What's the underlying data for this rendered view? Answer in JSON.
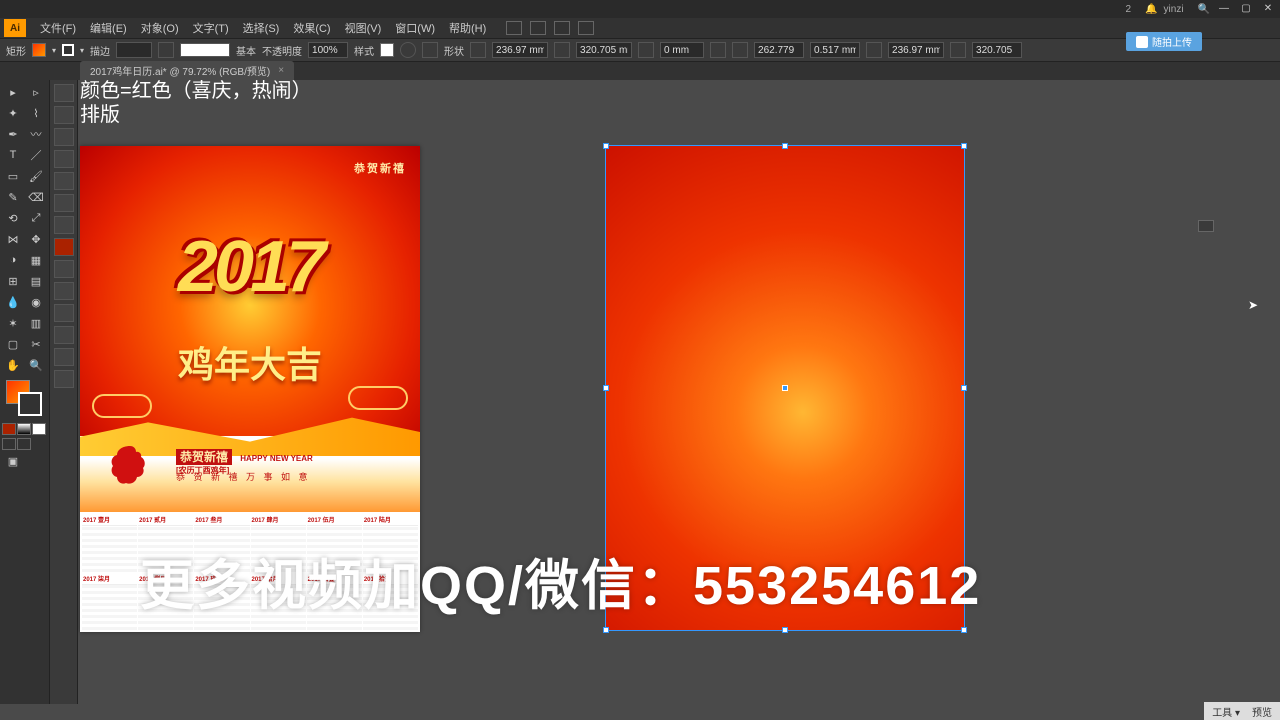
{
  "window": {
    "user": "yinzi",
    "notif": "2"
  },
  "menus": [
    "文件(F)",
    "编辑(E)",
    "对象(O)",
    "文字(T)",
    "选择(S)",
    "效果(C)",
    "视图(V)",
    "窗口(W)",
    "帮助(H)"
  ],
  "control": {
    "label1": "矩形",
    "stroke_label": "描边",
    "style_label": "基本",
    "opacity_label": "不透明度",
    "opacity_val": "100%",
    "style2": "样式",
    "shape_label": "形状",
    "w1": "236.97 mm",
    "h1": "320.705 mm",
    "x1": "0 mm",
    "r1": "262.779",
    "r2": "0.517 mm",
    "w2": "236.97 mm",
    "h2": "320.705"
  },
  "tab": {
    "name": "2017鸡年日历.ai* @ 79.72% (RGB/预览)"
  },
  "canvas_notes": {
    "line1": "颜色=红色（喜庆，热闹）",
    "line2": "排版"
  },
  "poster": {
    "corner": "恭贺新禧",
    "year": "2017",
    "subtitle": "鸡年大吉",
    "greet_en": "HAPPY NEW YEAR",
    "greet_sub": "[农历丁酉鸡年]",
    "greet2": "恭 贺 新 禧  万 事 如 意",
    "months": [
      "2017 壹月",
      "2017 贰月",
      "2017 叁月",
      "2017 肆月",
      "2017 伍月",
      "2017 陆月",
      "2017 柒月",
      "2017 捌月",
      "2017 玖月",
      "2017 拾月",
      "2017 拾壹",
      "2017 拾贰"
    ]
  },
  "sync": "随拍上传",
  "watermark": "更多视频加QQ/微信：553254612",
  "status": {
    "a": "工具 ▾",
    "b": "预览"
  }
}
